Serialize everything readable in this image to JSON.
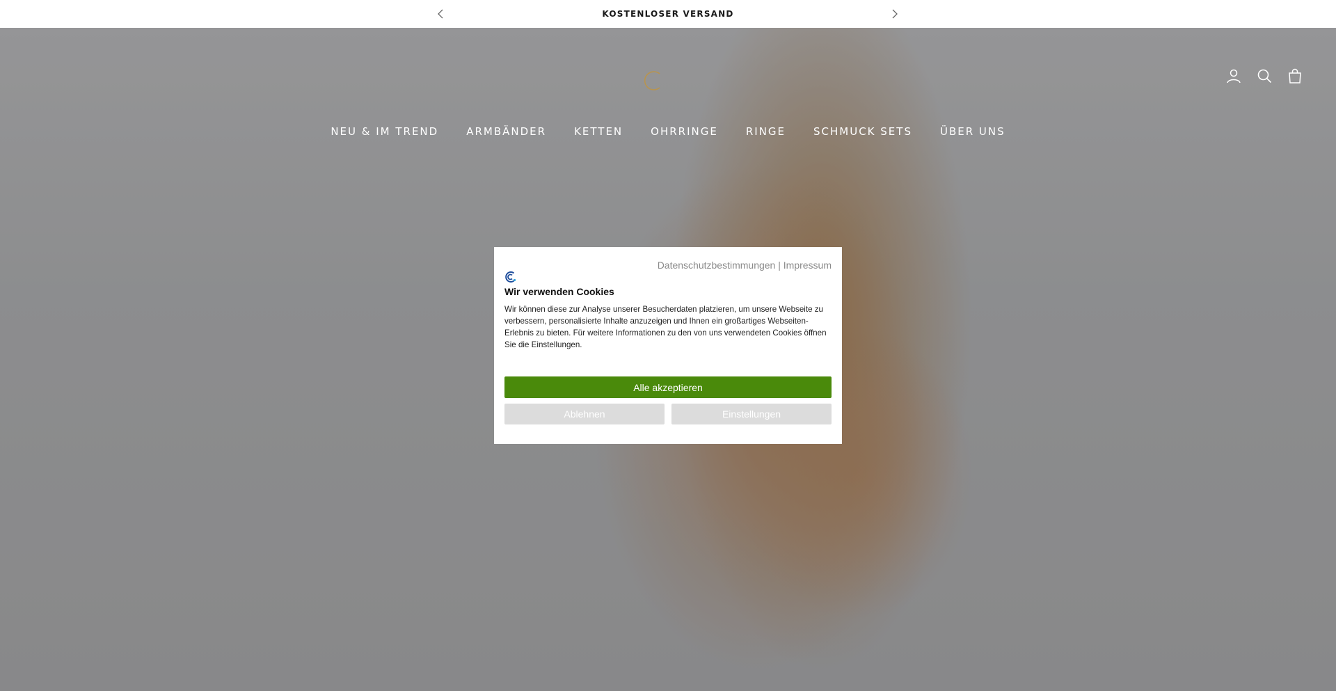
{
  "announcement": {
    "text": "KOSTENLOSER VERSAND",
    "prev_icon": "chevron-left-icon",
    "next_icon": "chevron-right-icon"
  },
  "header": {
    "logo_icon": "brand-logo-icon",
    "icons": [
      "account-icon",
      "search-icon",
      "cart-icon"
    ]
  },
  "nav": {
    "items": [
      "NEU & IM TREND",
      "ARMBÄNDER",
      "KETTEN",
      "OHRRINGE",
      "RINGE",
      "SCHMUCK SETS",
      "ÜBER UNS"
    ]
  },
  "cookie": {
    "links": {
      "privacy": "Datenschutzbestimmungen",
      "separator": " | ",
      "imprint": "Impressum"
    },
    "title": "Wir verwenden Cookies",
    "text": "Wir können diese zur Analyse unserer Besucherdaten platzieren, um unsere Webseite zu verbessern, personalisierte Inhalte anzuzeigen und Ihnen ein großartiges Webseiten-Erlebnis zu bieten. Für weitere Informationen zu den von uns verwendeten Cookies öffnen Sie die Einstellungen.",
    "accept_label": "Alle akzeptieren",
    "decline_label": "Ablehnen",
    "settings_label": "Einstellungen",
    "accent_color": "#4a8a0b"
  }
}
